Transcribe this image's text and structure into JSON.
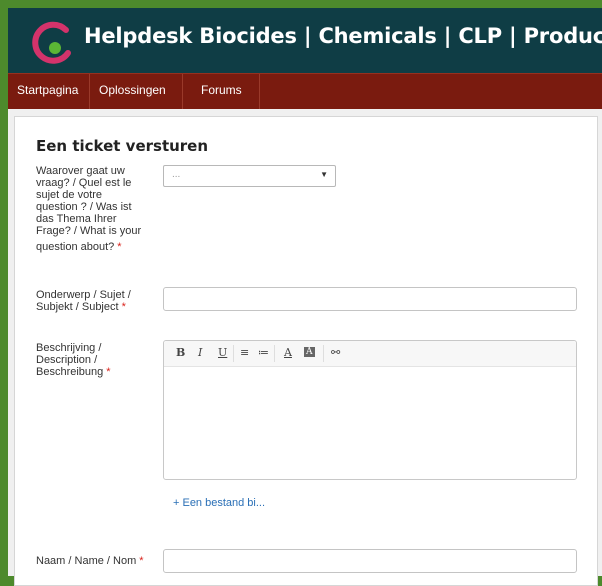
{
  "header": {
    "title": "Helpdesk Biocides | Chemicals | CLP | Products"
  },
  "nav": {
    "items": [
      "Startpagina",
      "Oplossingen",
      "Forums"
    ]
  },
  "form": {
    "title": "Een ticket versturen",
    "topic": {
      "label_lines": [
        "Waarover gaat uw",
        "vraag? / Quel est le",
        "sujet de votre",
        "question ? / Was ist",
        "das Thema Ihrer",
        "Frage? / What is your",
        "question about?"
      ],
      "value": "..."
    },
    "subject": {
      "label_lines": [
        "Onderwerp / Sujet /",
        "Subjekt / Subject"
      ]
    },
    "description": {
      "label_lines": [
        "Beschrijving /",
        "Description /",
        "Beschreibung"
      ],
      "toolbar": [
        "B",
        "I",
        "U",
        "≡",
        "≔",
        "A",
        "A",
        "⚯"
      ]
    },
    "attach_label": "+ Een bestand bi...",
    "name": {
      "label_lines": [
        "Naam / Name / Nom"
      ]
    },
    "required_mark": "*"
  },
  "colors": {
    "header": "#0f3d45",
    "nav": "#7a1b0f",
    "page": "#4d8a2c",
    "required": "#d9221b",
    "link": "#2a6fb6"
  }
}
